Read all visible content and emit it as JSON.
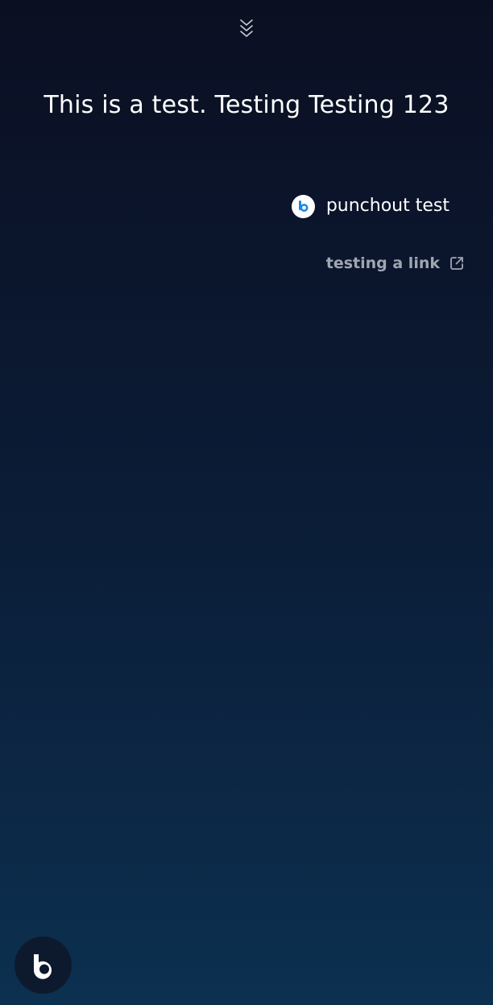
{
  "header": {
    "collapse_icon": "double-chevron-down-icon"
  },
  "response": {
    "text": "This is a test. Testing Testing 123"
  },
  "punchout": {
    "icon": "bixby-app-icon",
    "label": "punchout test"
  },
  "link": {
    "label": "testing a link",
    "icon": "external-link-icon"
  },
  "footer": {
    "assistant_icon": "bixby-logo-icon"
  },
  "colors": {
    "background_top": "#0b0f22",
    "background_bottom": "#0c3050",
    "link_text": "#9fa6b2",
    "accent_blue": "#1e88e5"
  }
}
